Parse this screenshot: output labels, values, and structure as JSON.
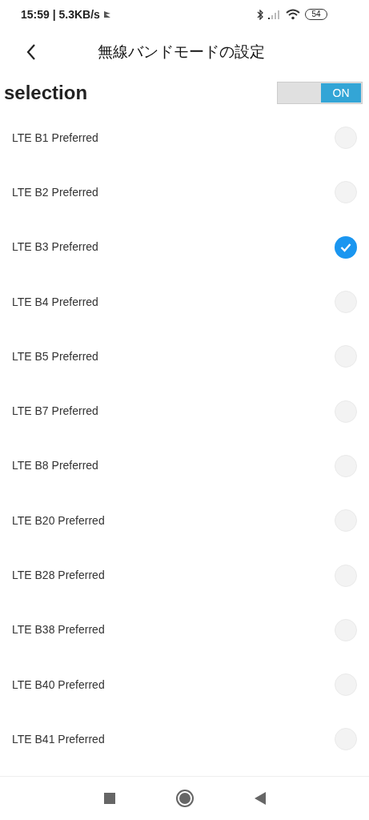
{
  "status_bar": {
    "time": "15:59 | 5.3KB/s",
    "battery": "54"
  },
  "header": {
    "title": "無線バンドモードの設定"
  },
  "selection": {
    "label": "selection",
    "toggle": {
      "on": true,
      "label": "ON"
    }
  },
  "options": [
    {
      "label": "LTE B1 Preferred",
      "selected": false
    },
    {
      "label": "LTE B2 Preferred",
      "selected": false
    },
    {
      "label": "LTE B3 Preferred",
      "selected": true
    },
    {
      "label": "LTE B4 Preferred",
      "selected": false
    },
    {
      "label": "LTE B5 Preferred",
      "selected": false
    },
    {
      "label": "LTE B7 Preferred",
      "selected": false
    },
    {
      "label": "LTE B8 Preferred",
      "selected": false
    },
    {
      "label": "LTE B20 Preferred",
      "selected": false
    },
    {
      "label": "LTE B28 Preferred",
      "selected": false
    },
    {
      "label": "LTE B38 Preferred",
      "selected": false
    },
    {
      "label": "LTE B40 Preferred",
      "selected": false
    },
    {
      "label": "LTE B41 Preferred",
      "selected": false
    }
  ]
}
